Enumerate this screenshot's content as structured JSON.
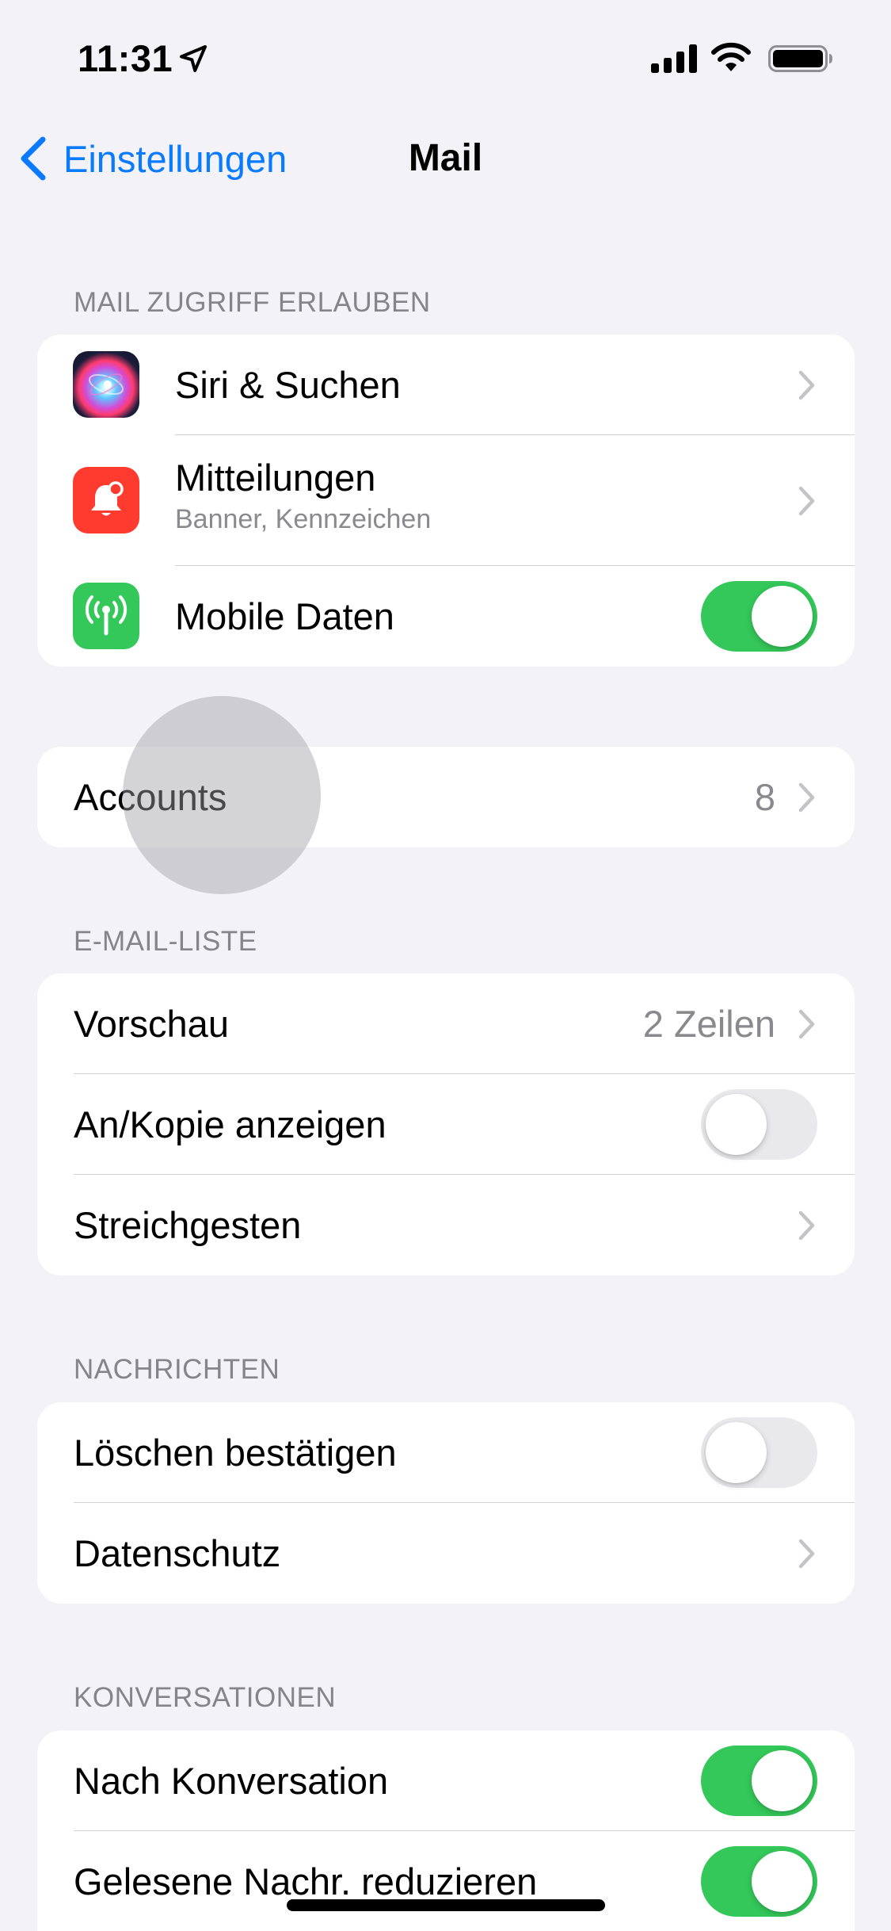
{
  "status_bar": {
    "time": "11:31",
    "icons": [
      "location-arrow-icon",
      "cellular-signal-icon",
      "wifi-icon",
      "battery-icon"
    ]
  },
  "nav": {
    "back_label": "Einstellungen",
    "title": "Mail"
  },
  "sections": {
    "allow_access": {
      "header": "MAIL ZUGRIFF ERLAUBEN",
      "siri": {
        "label": "Siri & Suchen",
        "icon": "siri-icon"
      },
      "notifications": {
        "label": "Mitteilungen",
        "subtitle": "Banner, Kennzeichen",
        "icon": "bell-icon"
      },
      "mobile_data": {
        "label": "Mobile Daten",
        "icon": "antenna-icon",
        "on": true
      }
    },
    "accounts": {
      "label": "Accounts",
      "value": "8"
    },
    "mail_list": {
      "header": "E-MAIL-LISTE",
      "preview": {
        "label": "Vorschau",
        "value": "2 Zeilen"
      },
      "show_to_cc": {
        "label": "An/Kopie anzeigen",
        "on": false
      },
      "swipe": {
        "label": "Streichgesten"
      }
    },
    "messages": {
      "header": "NACHRICHTEN",
      "confirm_delete": {
        "label": "Löschen bestätigen",
        "on": false
      },
      "privacy": {
        "label": "Datenschutz"
      }
    },
    "conversations": {
      "header": "KONVERSATIONEN",
      "by_thread": {
        "label": "Nach Konversation",
        "on": true
      },
      "collapse_read": {
        "label": "Gelesene Nachr. reduzieren",
        "on": true
      }
    }
  },
  "colors": {
    "background": "#f2f2f7",
    "accent": "#0a7aff",
    "toggle_on": "#34c759",
    "toggle_off": "#e9e9eb",
    "notification_red": "#ff3b30"
  }
}
